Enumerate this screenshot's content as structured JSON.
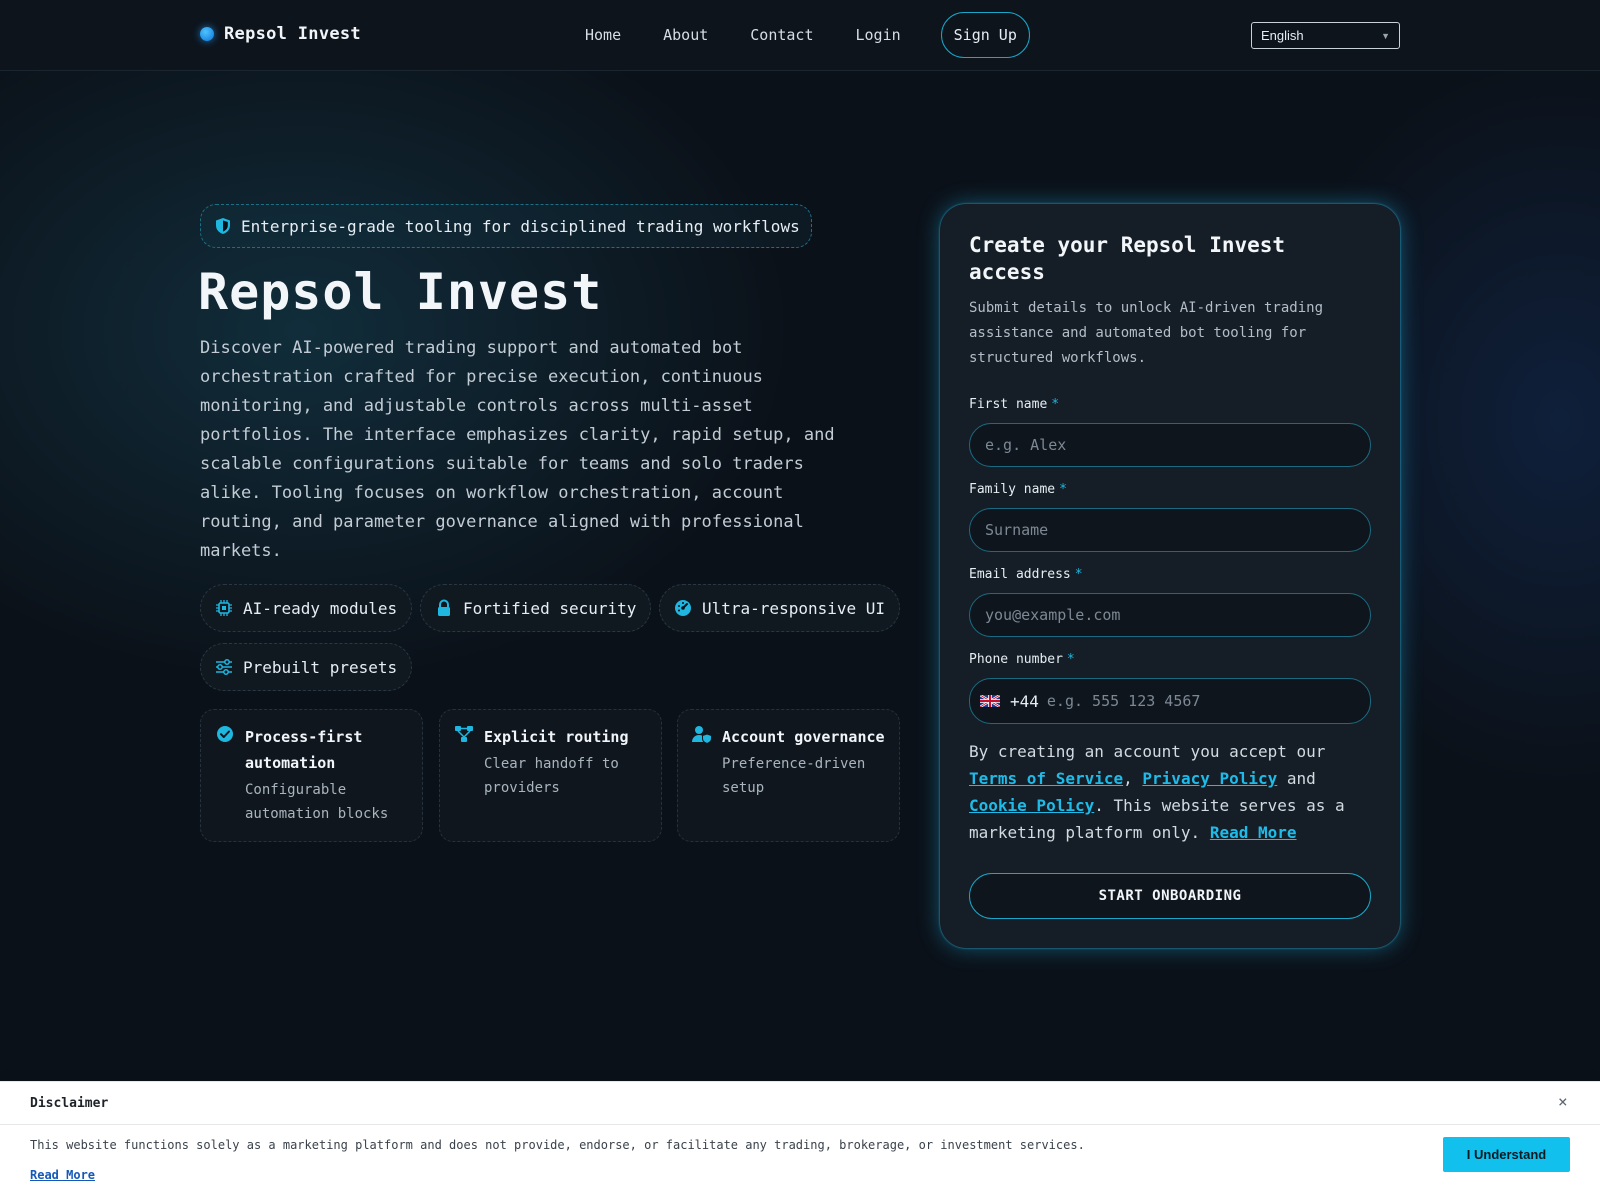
{
  "colors": {
    "accent": "#1fb6e0",
    "background": "#0b1119",
    "panel": "#151e27",
    "cta_button": "#12c0ee"
  },
  "header": {
    "brand": "Repsol Invest",
    "nav": {
      "home": "Home",
      "about": "About",
      "contact": "Contact",
      "login": "Login",
      "signup": "Sign Up"
    },
    "language": "English"
  },
  "hero": {
    "tagline": "Enterprise-grade tooling for disciplined trading workflows",
    "title": "Repsol Invest",
    "description": "Discover AI-powered trading support and automated bot orchestration crafted for precise execution, continuous monitoring, and adjustable controls across multi-asset portfolios. The interface emphasizes clarity, rapid setup, and scalable configurations suitable for teams and solo traders alike. Tooling focuses on workflow orchestration, account routing, and parameter governance aligned with professional markets.",
    "chips": [
      {
        "label": "AI-ready modules",
        "icon": "chip-icon"
      },
      {
        "label": "Fortified security",
        "icon": "lock-icon"
      },
      {
        "label": "Ultra-responsive UI",
        "icon": "gauge-icon"
      },
      {
        "label": "Prebuilt presets",
        "icon": "sliders-icon"
      }
    ],
    "cards": [
      {
        "title": "Process-first automation",
        "subtitle": "Configurable automation blocks",
        "icon": "check-circle-icon"
      },
      {
        "title": "Explicit routing",
        "subtitle": "Clear handoff to providers",
        "icon": "routing-icon"
      },
      {
        "title": "Account governance",
        "subtitle": "Preference-driven setup",
        "icon": "user-shield-icon"
      }
    ]
  },
  "form": {
    "title": "Create your Repsol Invest access",
    "subtitle": "Submit details to unlock AI-driven trading assistance and automated bot tooling for structured workflows.",
    "required_mark": "*",
    "first_name": {
      "label": "First name",
      "placeholder": "e.g. Alex"
    },
    "family_name": {
      "label": "Family name",
      "placeholder": "Surname"
    },
    "email": {
      "label": "Email address",
      "placeholder": "you@example.com"
    },
    "phone": {
      "label": "Phone number",
      "country_code": "+44",
      "placeholder": "e.g. 555 123 4567"
    },
    "consent": {
      "prefix": "By creating an account you accept our",
      "terms": "Terms of Service",
      "sep1": ",",
      "privacy": "Privacy Policy",
      "and": "and",
      "cookie": "Cookie Policy",
      "suffix": ". This website serves as a marketing platform only.",
      "read_more": "Read More"
    },
    "submit": "START ONBOARDING"
  },
  "disclaimer": {
    "title": "Disclaimer",
    "close": "×",
    "text": "This website functions solely as a marketing platform and does not provide, endorse, or facilitate any trading, brokerage, or investment services.",
    "read_more": "Read More",
    "button": "I Understand"
  }
}
